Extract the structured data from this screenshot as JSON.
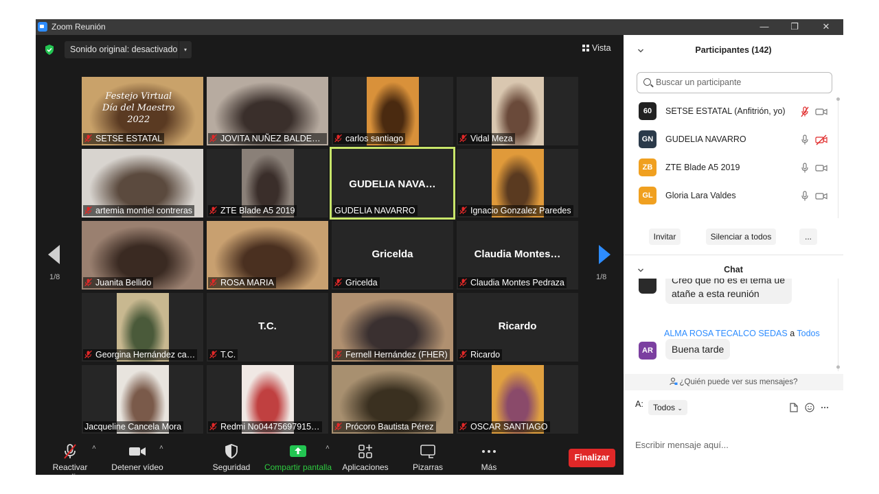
{
  "window": {
    "title": "Zoom Reunión",
    "min": "—",
    "restore": "❐",
    "close": "✕"
  },
  "topbar": {
    "sound": "Sonido original: desactivado",
    "caret": "▾",
    "view": "Vista"
  },
  "pager": {
    "left": "1/8",
    "right": "1/8"
  },
  "tiles": [
    {
      "name": "SETSE ESTATAL",
      "kind": "banner",
      "colors": [
        "#c9a26a",
        "#5a3a22"
      ],
      "banner_lines": [
        "Festejo Virtual",
        "Día del Maestro",
        "2022"
      ]
    },
    {
      "name": "JOVITA NUÑEZ BALDERAS",
      "kind": "video",
      "colors": [
        "#b7aba0",
        "#3a2f2b"
      ]
    },
    {
      "name": "carlos santiago",
      "kind": "image",
      "colors": [
        "#d9913a",
        "#4a2a10"
      ]
    },
    {
      "name": "Vidal Meza",
      "kind": "video",
      "colors": [
        "#d9c7b0",
        "#6a4a3a"
      ]
    },
    {
      "name": "artemia montiel contreras",
      "kind": "video",
      "colors": [
        "#d8d4cf",
        "#5b4a3e"
      ]
    },
    {
      "name": "ZTE Blade A5 2019",
      "kind": "video",
      "colors": [
        "#8a8078",
        "#3a2e2a"
      ]
    },
    {
      "name": "GUDELIA NAVARRO",
      "kind": "text",
      "center": "GUDELIA NAVA…",
      "active": true
    },
    {
      "name": "Ignacio Gonzalez Paredes",
      "kind": "video",
      "colors": [
        "#e09a3a",
        "#5a3a20"
      ]
    },
    {
      "name": "Juanita Bellido",
      "kind": "video",
      "colors": [
        "#9a8070",
        "#3a2a22"
      ]
    },
    {
      "name": "ROSA MARIA",
      "kind": "video",
      "colors": [
        "#c8a070",
        "#4a3020"
      ]
    },
    {
      "name": "Gricelda",
      "kind": "text",
      "center": "Gricelda"
    },
    {
      "name": "Claudia Montes Pedraza",
      "kind": "text",
      "center": "Claudia  Montes…"
    },
    {
      "name": "Georgina Hernández ca…",
      "kind": "video",
      "colors": [
        "#c8b890",
        "#4a5a3a"
      ]
    },
    {
      "name": "T.C.",
      "kind": "text",
      "center": "T.C."
    },
    {
      "name": "Fernell Hernández (FHER)",
      "kind": "video",
      "colors": [
        "#b09070",
        "#3a3030"
      ]
    },
    {
      "name": "Ricardo",
      "kind": "text",
      "center": "Ricardo"
    },
    {
      "name": "Jacqueline Cancela Mora",
      "kind": "video",
      "colors": [
        "#e8e4de",
        "#7a5a4a"
      ]
    },
    {
      "name": "Redmi No04475697915…",
      "kind": "image",
      "colors": [
        "#f0e8e4",
        "#c04040"
      ]
    },
    {
      "name": "Prócoro Bautista Pérez",
      "kind": "video",
      "colors": [
        "#a89070",
        "#3a3020"
      ]
    },
    {
      "name": "OSCAR SANTIAGO",
      "kind": "video",
      "colors": [
        "#e0a040",
        "#8a4a6a"
      ]
    }
  ],
  "toolbar": {
    "audio": "Reactivar audio",
    "video": "Detener vídeo",
    "security": "Seguridad",
    "share": "Compartir pantalla",
    "apps": "Aplicaciones",
    "whiteboards": "Pizarras",
    "more": "Más",
    "end": "Finalizar",
    "caret": "˄"
  },
  "participants": {
    "title": "Participantes (142)",
    "search_placeholder": "Buscar un participante",
    "list": [
      {
        "initials": "60",
        "name": "SETSE ESTATAL (Anfitrión, yo)",
        "color": "#222222",
        "mic_muted": true,
        "cam_off": false
      },
      {
        "initials": "GN",
        "name": "GUDELIA NAVARRO",
        "color": "#2b3a4a",
        "mic_muted": false,
        "cam_off": true
      },
      {
        "initials": "ZB",
        "name": "ZTE Blade A5 2019",
        "color": "#f0a020",
        "mic_muted": false,
        "cam_off": false
      },
      {
        "initials": "GL",
        "name": "Gloria  Lara Valdes",
        "color": "#f0a020",
        "mic_muted": false,
        "cam_off": false
      }
    ],
    "invite": "Invitar",
    "mute_all": "Silenciar a todos",
    "more": "..."
  },
  "chat": {
    "title": "Chat",
    "prev_message": "Creo que no es el tema ue atañe a esta reunión",
    "sender": "ALMA ROSA TECALCO SEDAS",
    "to_word": "a",
    "to_target": "Todos",
    "avatar": "AR",
    "avatar_color": "#7b3fa0",
    "message": "Buena tarde",
    "who_can_see": "¿Quién puede ver sus mensajes?",
    "to_label": "A:",
    "recipient": "Todos",
    "input_placeholder": "Escribir mensaje aquí..."
  }
}
